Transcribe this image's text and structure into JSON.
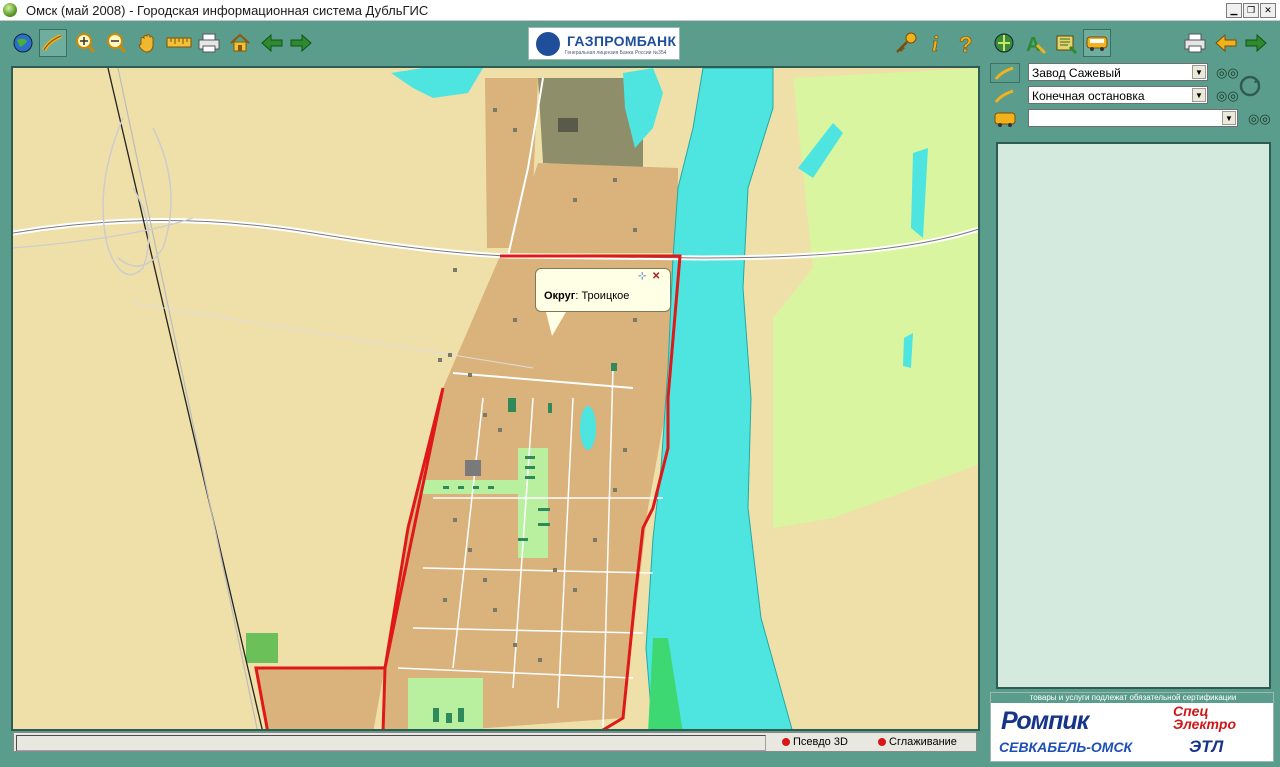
{
  "window": {
    "title": "Омск (май 2008) - Городская информационная система ДубльГИС",
    "controls": [
      "minimize",
      "restore",
      "close"
    ]
  },
  "toolbar": {
    "left_tools": [
      {
        "name": "globe-icon"
      },
      {
        "name": "route-icon",
        "active": true
      },
      {
        "name": "zoom-in-icon"
      },
      {
        "name": "zoom-out-icon"
      },
      {
        "name": "hand-pan-icon"
      },
      {
        "name": "ruler-icon"
      },
      {
        "name": "printer-icon"
      },
      {
        "name": "home-icon"
      },
      {
        "name": "back-arrow-icon"
      },
      {
        "name": "forward-arrow-icon"
      }
    ],
    "banner": {
      "name": "ГАЗПРОМБАНК",
      "subtitle": "Генеральная лицензия Банка России №354"
    },
    "right_tools": [
      {
        "name": "key-icon"
      },
      {
        "name": "info-icon"
      },
      {
        "name": "help-icon"
      }
    ]
  },
  "side_toolbar": {
    "tools": [
      {
        "name": "directory-icon"
      },
      {
        "name": "address-search-icon"
      },
      {
        "name": "rubric-search-icon"
      },
      {
        "name": "transport-icon",
        "active": true
      }
    ],
    "right": [
      {
        "name": "print-icon"
      },
      {
        "name": "back-arrow-icon"
      },
      {
        "name": "forward-arrow-icon"
      }
    ]
  },
  "route": {
    "from": "Завод Сажевый",
    "to": "Конечная остановка",
    "transport": ""
  },
  "map": {
    "callout": {
      "label": "Округ",
      "value": ": Троицкое"
    },
    "colors": {
      "land": "#efe0aa",
      "district": "#d9b27c",
      "river": "#4ee5e0",
      "green": "#d9f5a0",
      "boundary": "#e01818"
    }
  },
  "statusbar": {
    "pseudo3d": "Псевдо 3D",
    "smoothing": "Сглаживание"
  },
  "ads": {
    "certification": "товары и услуги подлежат обязательной сертификации",
    "ad1": "Ромпик",
    "ad2": "Спец\nЭлектро",
    "ad3": "СЕВКАБЕЛЬ-ОМСК",
    "ad4": "ЭТЛ"
  }
}
